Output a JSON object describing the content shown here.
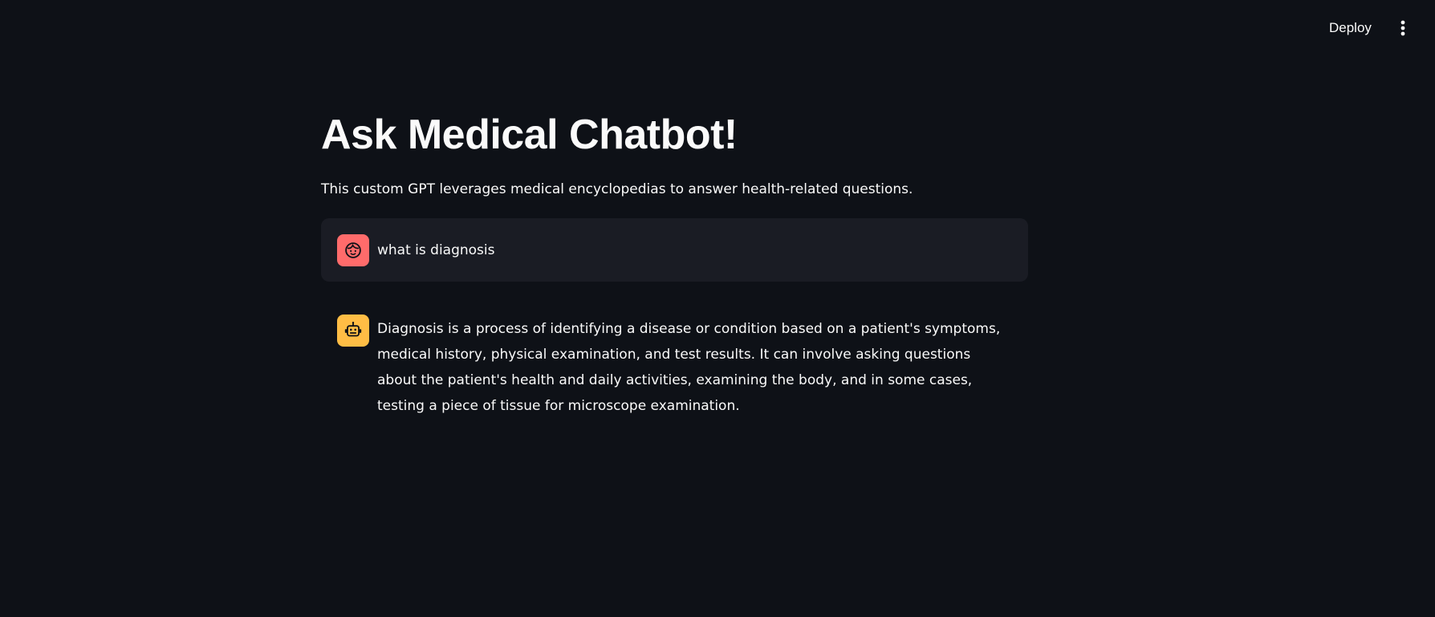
{
  "header": {
    "deploy_label": "Deploy",
    "menu_icon": "vertical-ellipsis-icon"
  },
  "main": {
    "title": "Ask Medical Chatbot!",
    "caption": "This custom GPT leverages medical encyclopedias to answer health-related questions."
  },
  "chat": {
    "messages": [
      {
        "role": "user",
        "avatar_icon": "user-face-icon",
        "avatar_color": "#ff6b6b",
        "text": "what is diagnosis"
      },
      {
        "role": "assistant",
        "avatar_icon": "robot-icon",
        "avatar_color": "#ffbd45",
        "text": "Diagnosis is a process of identifying a disease or condition based on a patient's symptoms, medical history, physical examination, and test results. It can involve asking questions about the patient's health and daily activities, examining the body, and in some cases, testing a piece of tissue for microscope examination."
      }
    ]
  },
  "colors": {
    "background": "#0e1117",
    "user_message_background": "#1a1c24",
    "text": "#fafafa"
  }
}
